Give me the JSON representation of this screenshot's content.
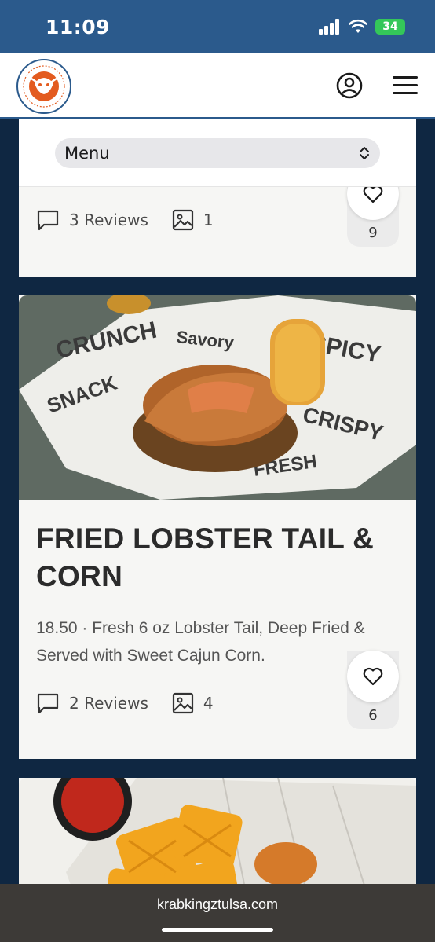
{
  "status_bar": {
    "time": "11:09",
    "battery": "34",
    "icons": [
      "signal-icon",
      "wifi-icon",
      "battery-icon"
    ]
  },
  "header": {
    "logo_icon": "crab-catfish-logo",
    "account_icon": "user-circle-icon",
    "menu_icon": "hamburger-icon"
  },
  "menu_select": {
    "label": "Menu"
  },
  "items": [
    {
      "reviews": "3 Reviews",
      "photos": "1",
      "likes": "9"
    },
    {
      "title": "FRIED LOBSTER TAIL & CORN",
      "description": "18.50 · Fresh 6 oz Lobster Tail, Deep Fried & Served with Sweet Cajun Corn.",
      "reviews": "2 Reviews",
      "photos": "4",
      "likes": "6"
    }
  ],
  "url_bar": {
    "url": "krabkingztulsa.com"
  },
  "colors": {
    "brand_blue": "#2b5a8c",
    "page_bg": "#0f2742",
    "accent_orange": "#e35b1f"
  }
}
